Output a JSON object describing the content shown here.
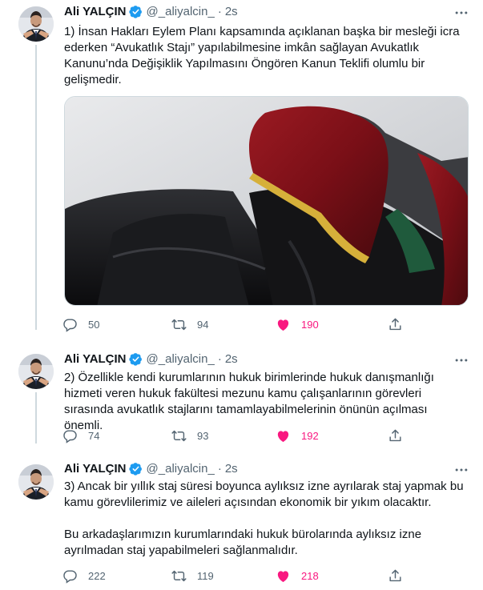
{
  "author": {
    "name": "Ali YALÇIN",
    "handle": "@_aliyalcin_",
    "separator": "·",
    "time": "2s"
  },
  "tweets": [
    {
      "paragraphs": [
        "1) İnsan Hakları Eylem Planı kapsamında açıklanan başka bir mesleği icra ederken “Avukatlık Stajı” yapılabilmesine imkân sağlayan Avukatlık Kanunu’nda Değişiklik Yapılmasını Öngören Kanun Teklifi olumlu bir gelişmedir."
      ],
      "replies": "50",
      "retweets": "94",
      "likes": "190"
    },
    {
      "paragraphs": [
        "2) Özellikle kendi kurumlarının hukuk birimlerinde hukuk danışmanlığı hizmeti veren hukuk fakültesi mezunu kamu çalışanlarının görevleri sırasında avukatlık stajlarını tamamlayabilmelerinin önünün açılması önemli."
      ],
      "replies": "74",
      "retweets": "93",
      "likes": "192"
    },
    {
      "paragraphs": [
        "3) Ancak bir yıllık staj süresi boyunca aylıksız izne ayrılarak staj yapmak bu kamu görevlilerimiz ve aileleri açısından ekonomik bir yıkım olacaktır.",
        "Bu arkadaşlarımızın kurumlarındaki hukuk bürolarında aylıksız izne ayrılmadan staj yapabilmeleri sağlanmalıdır."
      ],
      "replies": "222",
      "retweets": "119",
      "likes": "218"
    }
  ],
  "colors": {
    "text": "#0f1419",
    "secondary": "#536471",
    "verified": "#1d9bf0",
    "like": "#f91880",
    "thread_line": "#cfd9de"
  },
  "icons": [
    "reply-icon",
    "retweet-icon",
    "like-icon",
    "share-icon",
    "verified-badge-icon",
    "more-options-icon"
  ]
}
